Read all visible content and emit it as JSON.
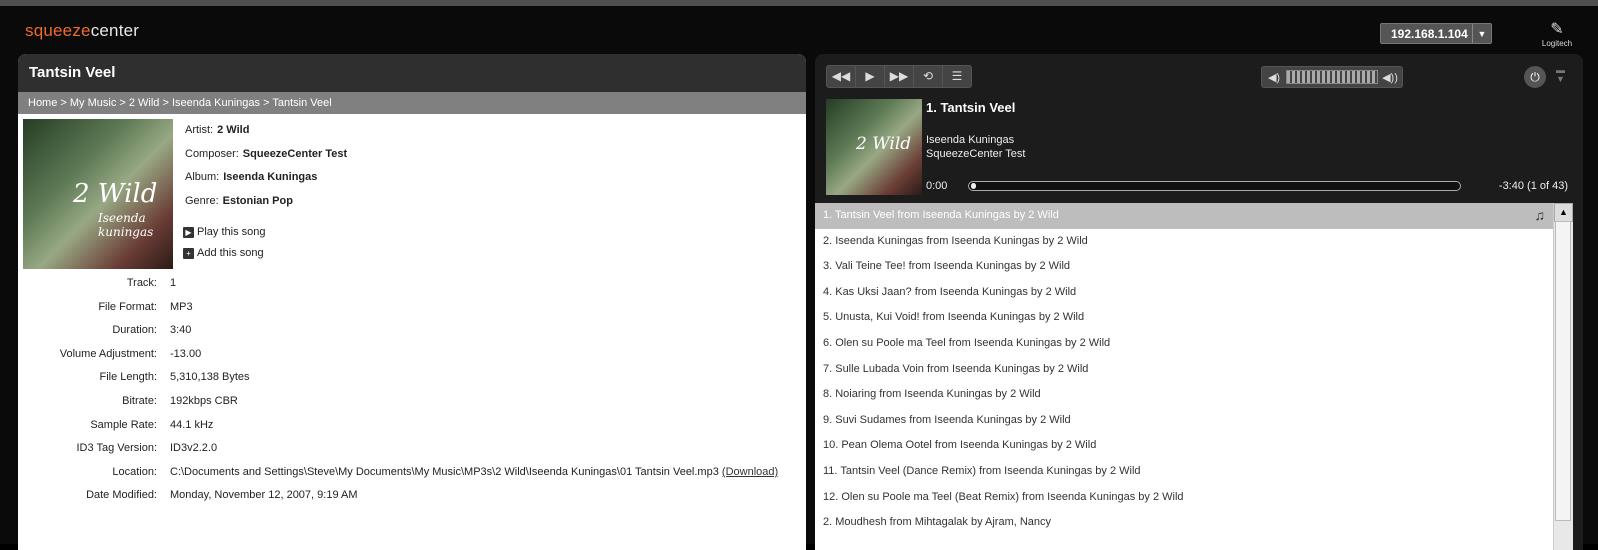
{
  "app": {
    "logo_part1": "squeeze",
    "logo_part2": "center",
    "player_ip": "192.168.1.104",
    "brand": "Logitech"
  },
  "song_panel": {
    "title": "Tantsin Veel",
    "breadcrumb": "Home > My Music > 2 Wild > Iseenda Kuningas > Tantsin Veel",
    "cover_text_1": "2 Wild",
    "cover_text_2": "Iseenda kuningas",
    "artist_label": "Artist:",
    "artist": "2 Wild",
    "composer_label": "Composer:",
    "composer": "SqueezeCenter Test",
    "album_label": "Album:",
    "album": "Iseenda Kuningas",
    "genre_label": "Genre:",
    "genre": "Estonian Pop",
    "play_label": "Play this song",
    "add_label": "Add this song",
    "details": [
      {
        "label": "Track:",
        "value": "1"
      },
      {
        "label": "File Format:",
        "value": "MP3"
      },
      {
        "label": "Duration:",
        "value": "3:40"
      },
      {
        "label": "Volume Adjustment:",
        "value": "-13.00"
      },
      {
        "label": "File Length:",
        "value": "5,310,138 Bytes"
      },
      {
        "label": "Bitrate:",
        "value": "192kbps CBR"
      },
      {
        "label": "Sample Rate:",
        "value": "44.1 kHz"
      },
      {
        "label": "ID3 Tag Version:",
        "value": "ID3v2.2.0"
      },
      {
        "label": "Location:",
        "value": "C:\\Documents and Settings\\Steve\\My Documents\\My Music\\MP3s\\2 Wild\\Iseenda Kuningas\\01 Tantsin Veel.mp3"
      },
      {
        "label": "Date Modified:",
        "value": "Monday, November 12, 2007, 9:19 AM"
      }
    ],
    "download_label": "(Download)"
  },
  "player": {
    "icons": {
      "rewind": "◀◀",
      "play": "▶",
      "forward": "▶▶",
      "repeat": "⟲",
      "shuffle": "☰",
      "vol_down": "◀)",
      "vol_up": "◀))",
      "power": "⏻",
      "menu": "▬\n▼"
    },
    "volume_level": 0.85,
    "now_playing_title": "1. Tantsin Veel",
    "now_playing_album": "Iseenda Kuningas",
    "now_playing_artist": "SqueezeCenter Test",
    "elapsed": "0:00",
    "remaining": "-3:40 (1 of 43)",
    "progress": 0.0
  },
  "playlist": [
    "1. Tantsin Veel from Iseenda Kuningas by 2 Wild",
    "2. Iseenda Kuningas from Iseenda Kuningas by 2 Wild",
    "3. Vali Teine Tee! from Iseenda Kuningas by 2 Wild",
    "4. Kas Uksi Jaan? from Iseenda Kuningas by 2 Wild",
    "5. Unusta, Kui Void! from Iseenda Kuningas by 2 Wild",
    "6. Olen su Poole ma Teel from Iseenda Kuningas by 2 Wild",
    "7. Sulle Lubada Voin from Iseenda Kuningas by 2 Wild",
    "8. Noiaring from Iseenda Kuningas by 2 Wild",
    "9. Suvi Sudames from Iseenda Kuningas by 2 Wild",
    "10. Pean Olema Ootel from Iseenda Kuningas by 2 Wild",
    "11. Tantsin Veel (Dance Remix) from Iseenda Kuningas by 2 Wild",
    "12. Olen su Poole ma Teel (Beat Remix) from Iseenda Kuningas by 2 Wild",
    "2. Moudhesh from Mihtagalak by Ajram, Nancy"
  ]
}
